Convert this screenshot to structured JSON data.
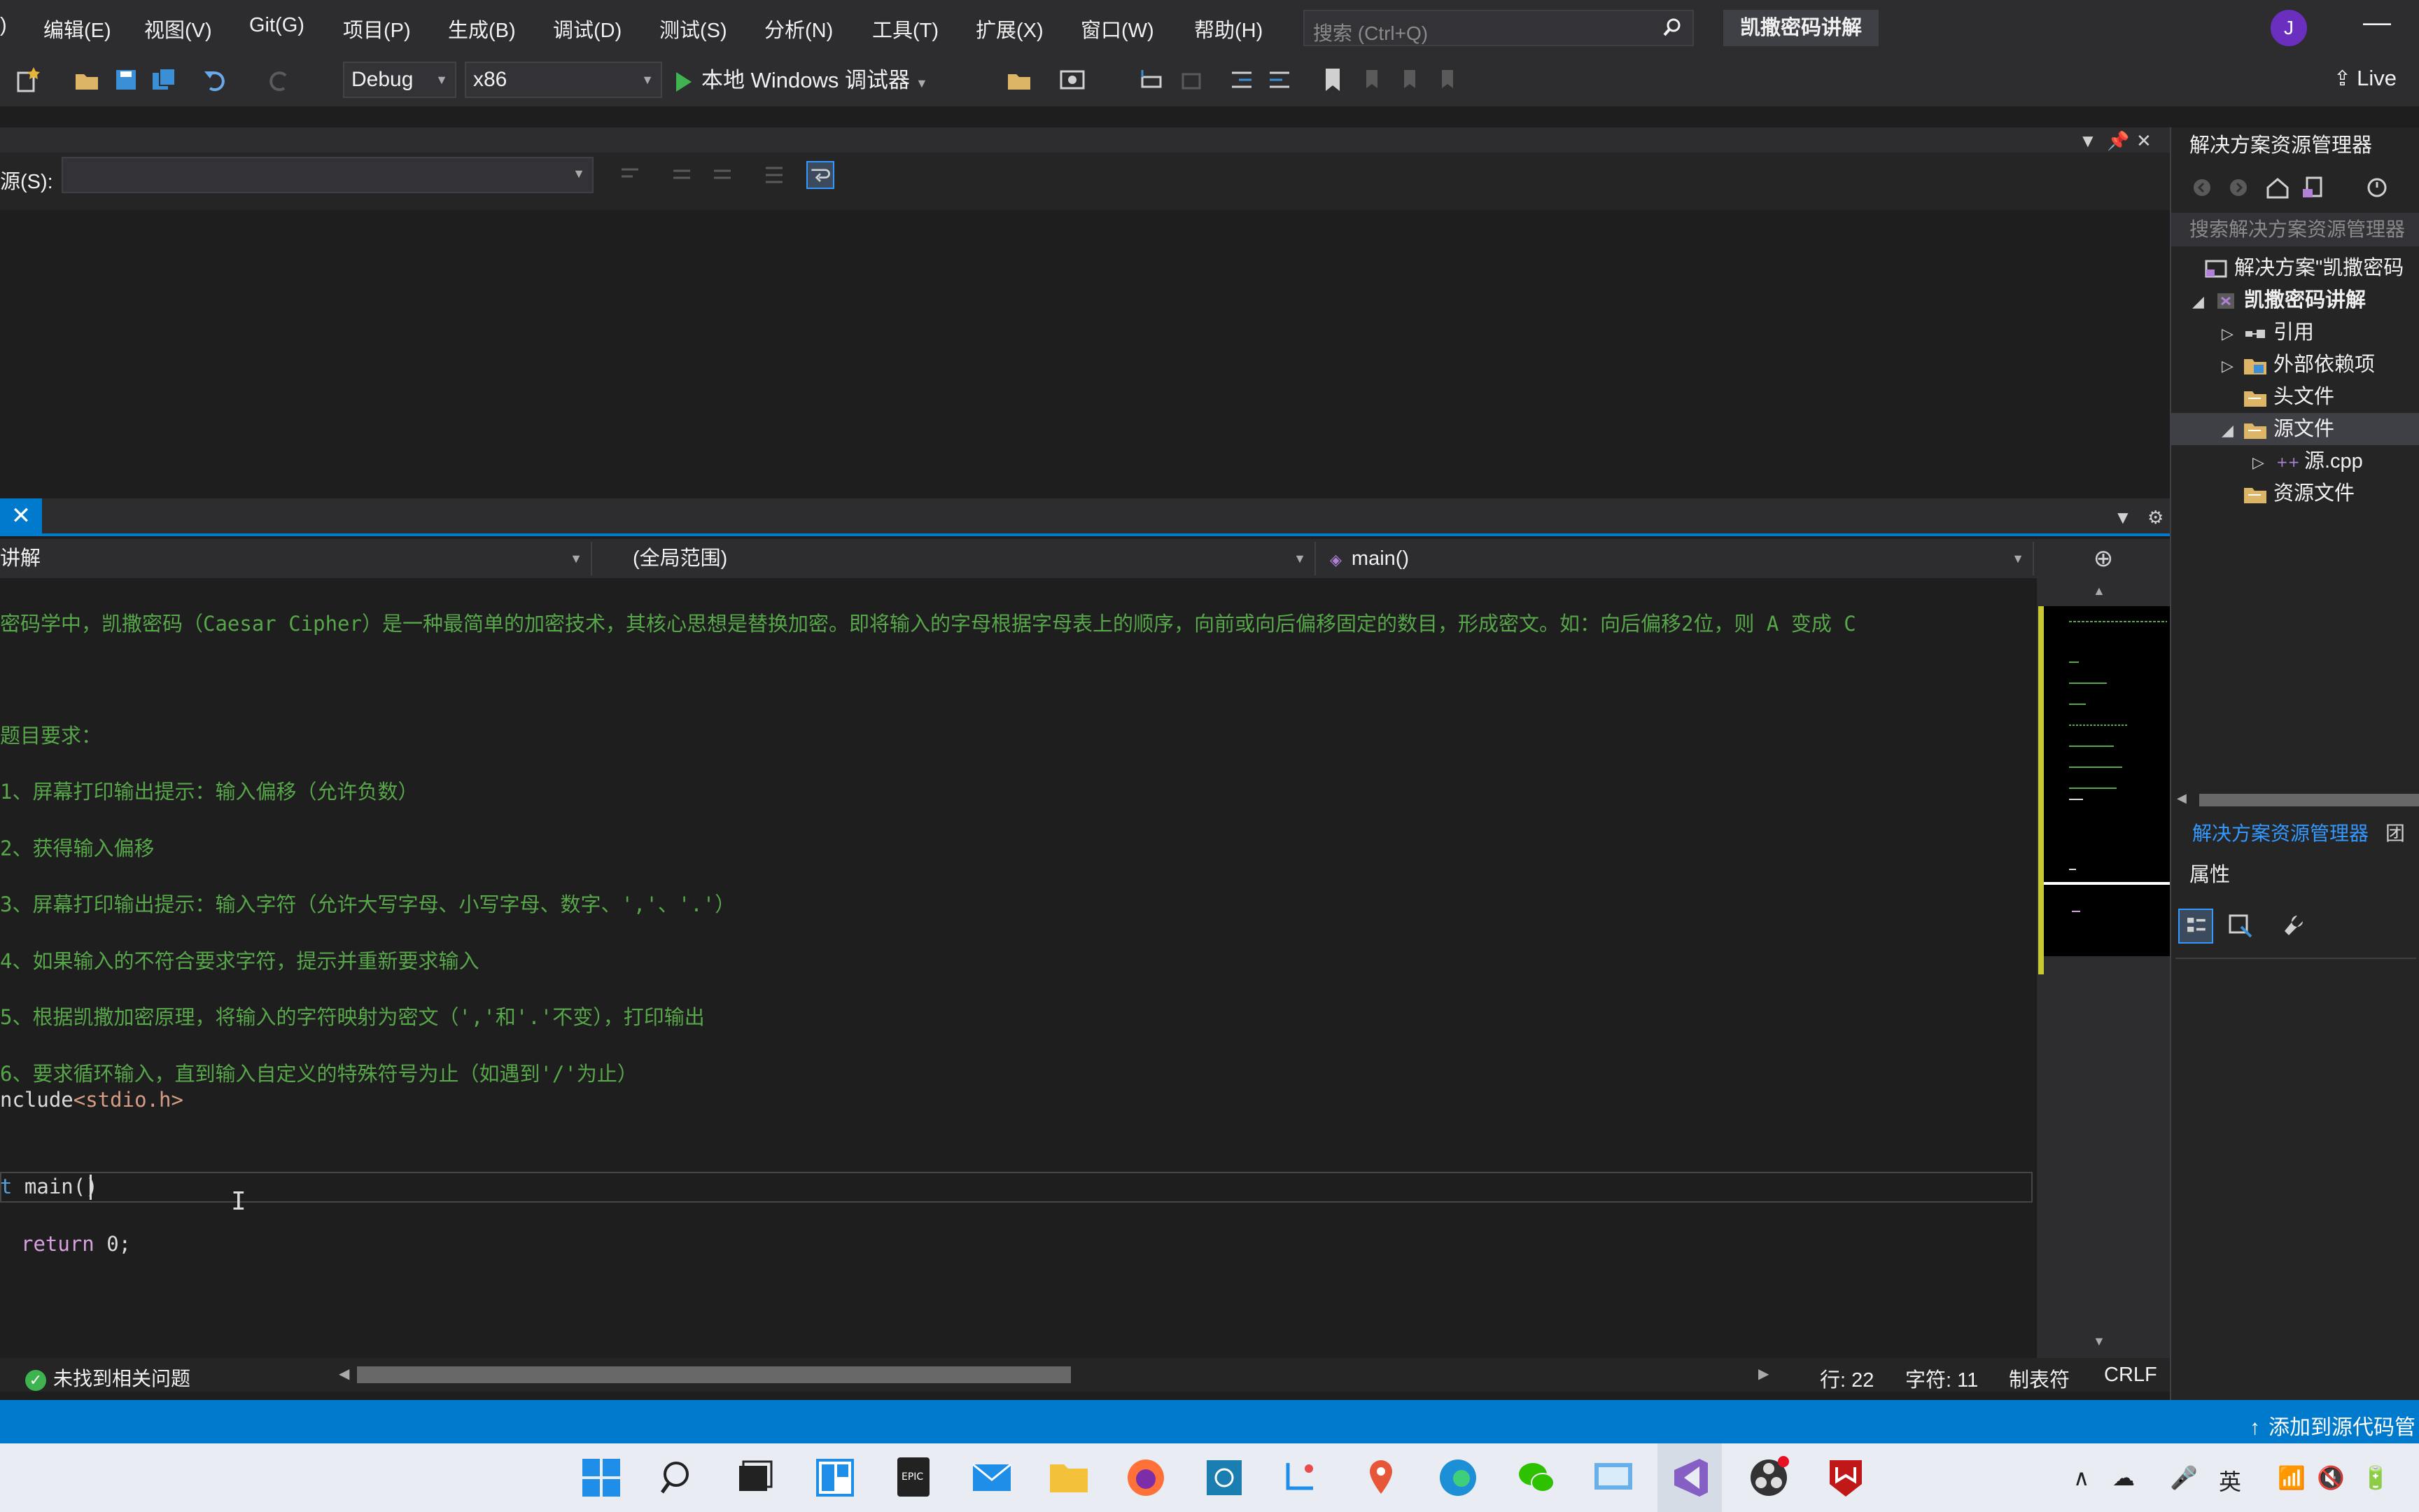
{
  "menubar": {
    "items": [
      "编辑(E)",
      "视图(V)",
      "Git(G)",
      "项目(P)",
      "生成(B)",
      "调试(D)",
      "测试(S)",
      "分析(N)",
      "工具(T)",
      "扩展(X)",
      "窗口(W)",
      "帮助(H)"
    ],
    "leading_fragment": ")",
    "search_placeholder": "搜索 (Ctrl+Q)",
    "solution_title": "凯撒密码讲解",
    "avatar_letter": "J"
  },
  "toolbar": {
    "config": "Debug",
    "platform": "x86",
    "run_label": "本地 Windows 调试器",
    "live_share": "Live"
  },
  "output_panel": {
    "source_label": "源(S):"
  },
  "nav_bar": {
    "project": "讲解",
    "scope": "(全局范围)",
    "member": "main()"
  },
  "editor": {
    "lines": [
      "密码学中，凯撒密码（Caesar Cipher）是一种最简单的加密技术，其核心思想是替换加密。即将输入的字母根据字母表上的顺序，向前或向后偏移固定的数目，形成密文。如：向后偏移2位，则 A 变成 C",
      "题目要求：",
      "1、屏幕打印输出提示：输入偏移（允许负数）",
      "2、获得输入偏移",
      "3、屏幕打印输出提示：输入字符（允许大写字母、小写字母、数字、','、'.'）",
      "4、如果输入的不符合要求字符，提示并重新要求输入",
      "5、根据凯撒加密原理，将输入的字符映射为密文（','和'.'不变），打印输出",
      "6、要求循环输入，直到输入自定义的特殊符号为止（如遇到'/'为止）"
    ],
    "include_kw": "nclude",
    "include_hdr": "<stdio.h>",
    "main_type": "t",
    "main_sig": " main()",
    "return_kw": "return",
    "return_val": " 0;"
  },
  "status": {
    "issues": "未找到相关问题",
    "line": "行: 22",
    "char": "字符: 11",
    "indent": "制表符",
    "eol": "CRLF",
    "source_control": "添加到源代码管"
  },
  "solution_explorer": {
    "title": "解决方案资源管理器",
    "search": "搜索解决方案资源管理器",
    "tree": [
      {
        "label": "解决方案\"凯撒密码",
        "icon": "solution-icon",
        "indent": 0,
        "expander": ""
      },
      {
        "label": "凯撒密码讲解",
        "icon": "project-icon",
        "indent": 1,
        "expander": "◢"
      },
      {
        "label": "引用",
        "icon": "references-icon",
        "indent": 2,
        "expander": "▷"
      },
      {
        "label": "外部依赖项",
        "icon": "external-deps-icon",
        "indent": 2,
        "expander": "▷"
      },
      {
        "label": "头文件",
        "icon": "folder-icon",
        "indent": 2,
        "expander": ""
      },
      {
        "label": "源文件",
        "icon": "folder-icon",
        "indent": 2,
        "expander": "◢"
      },
      {
        "label": "源.cpp",
        "icon": "cpp-file-icon",
        "indent": 3,
        "expander": "▷"
      },
      {
        "label": "资源文件",
        "icon": "folder-icon",
        "indent": 2,
        "expander": ""
      }
    ],
    "bottom_tab": "解决方案资源管理器",
    "bottom_tab2": "团",
    "properties_title": "属性"
  },
  "taskbar": {
    "ime": "英"
  }
}
